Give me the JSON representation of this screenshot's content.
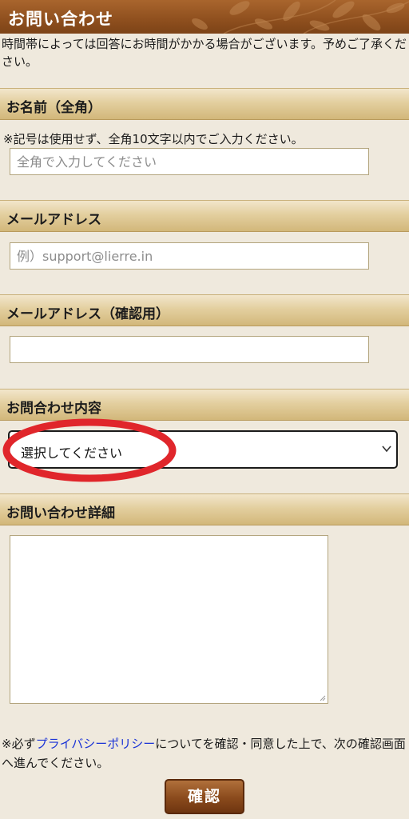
{
  "header": {
    "title": "お問い合わせ"
  },
  "intro_text": "時間帯によっては回答にお時間がかかる場合がございます。予めご了承ください。",
  "fields": {
    "name": {
      "label": "お名前（全角）",
      "note": "※記号は使用せず、全角10文字以内でご入力ください。",
      "placeholder": "全角で入力してください",
      "value": ""
    },
    "email": {
      "label": "メールアドレス",
      "placeholder": "例）support@lierre.in",
      "value": ""
    },
    "email_confirm": {
      "label": "メールアドレス（確認用）",
      "placeholder": "",
      "value": ""
    },
    "inquiry_type": {
      "label": "お問合わせ内容",
      "selected": "選択してください"
    },
    "details": {
      "label": "お問い合わせ詳細",
      "value": ""
    }
  },
  "policy": {
    "prefix": "※必ず",
    "link_text": "プライバシーポリシー",
    "suffix": "についてを確認・同意した上で、次の確認画面へ進んでください。"
  },
  "confirm_label": "確認",
  "colors": {
    "header_bar": "#8e4f1e",
    "section_band": "#e3cf9f",
    "page_bg": "#efe9dd",
    "link": "#1a33d6",
    "highlight_ring": "#e0262b"
  }
}
